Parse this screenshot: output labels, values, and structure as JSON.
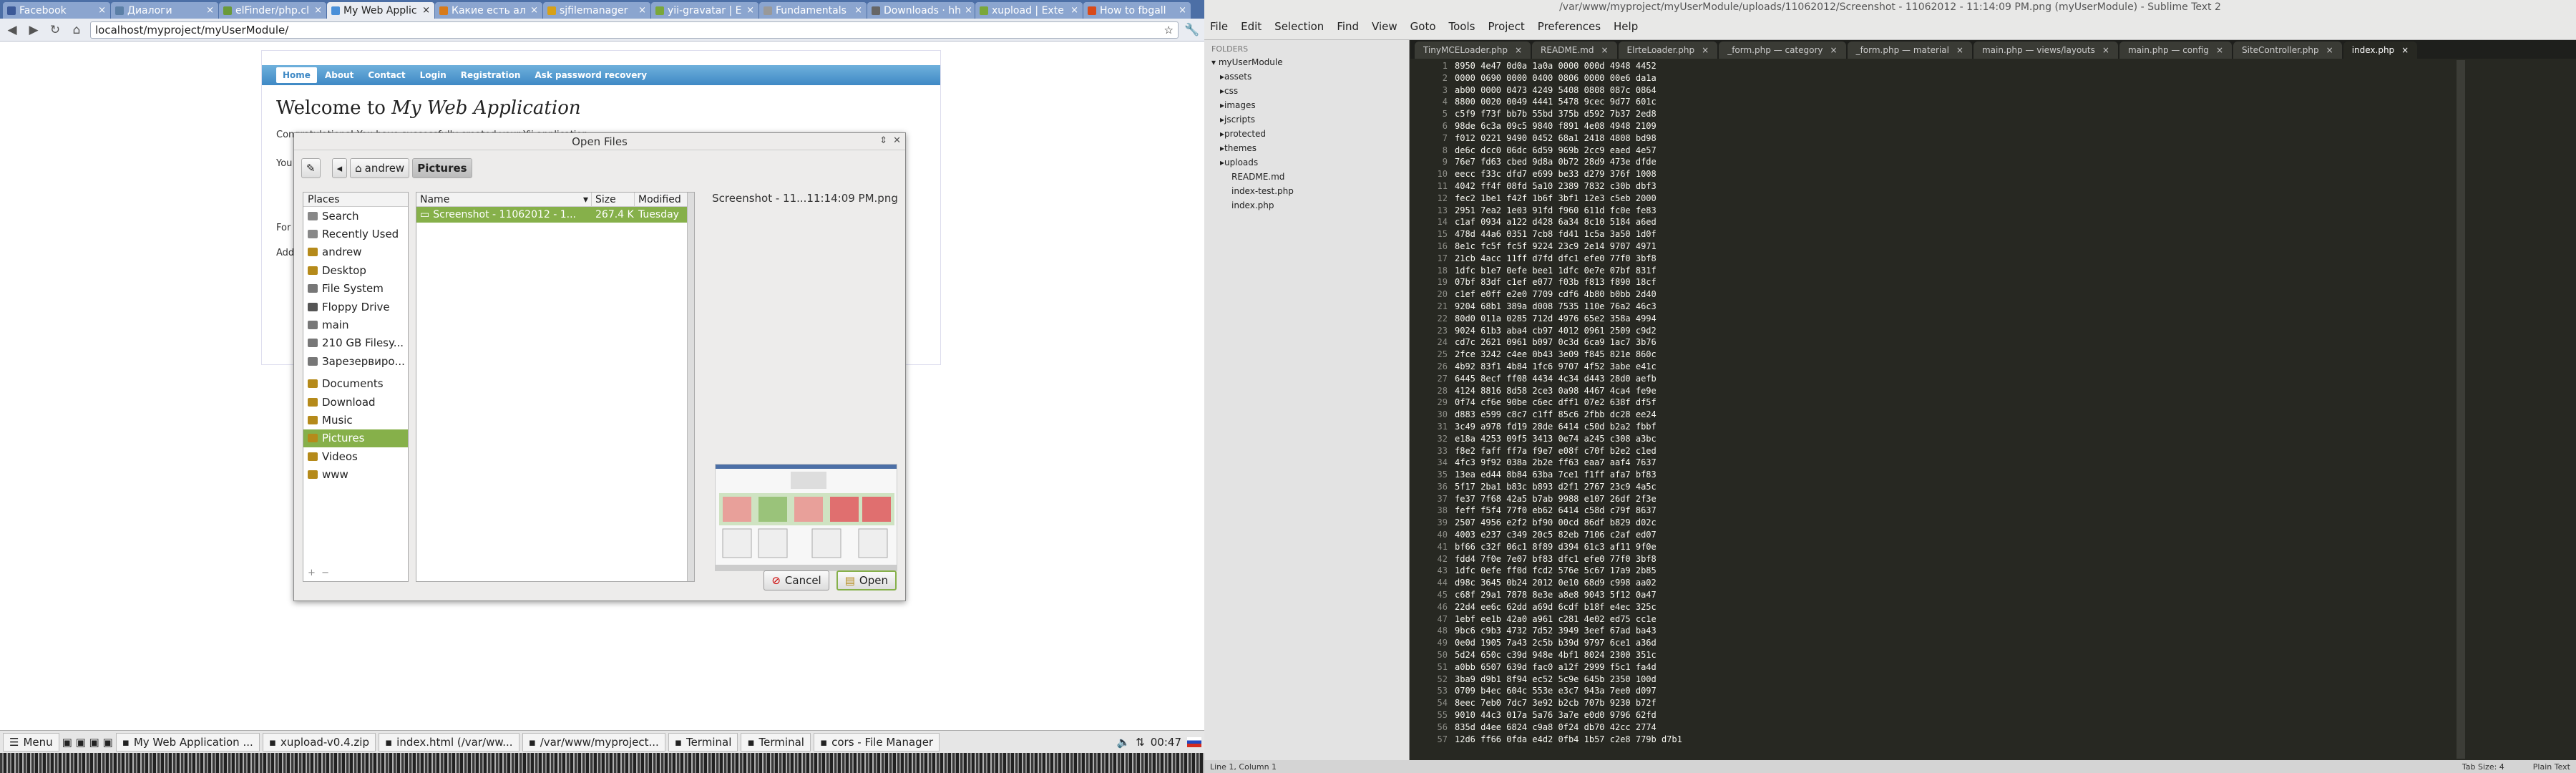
{
  "chrome": {
    "tabs": [
      {
        "label": "Facebook",
        "color": "#3b5998"
      },
      {
        "label": "Диалоги",
        "color": "#5b7fa6"
      },
      {
        "label": "elFinder/php.cl",
        "color": "#6a9a3a"
      },
      {
        "label": "My Web Applic",
        "color": "#4a90d9"
      },
      {
        "label": "Какие есть ал",
        "color": "#d77a1a"
      },
      {
        "label": "sjfilemanager",
        "color": "#d6a018"
      },
      {
        "label": "yii-gravatar | E",
        "color": "#7aa73a"
      },
      {
        "label": "Fundamentals",
        "color": "#999999"
      },
      {
        "label": "Downloads · hh",
        "color": "#666666"
      },
      {
        "label": "xupload | Exte",
        "color": "#7aa73a"
      },
      {
        "label": "How to fbgall",
        "color": "#d84a1a"
      }
    ],
    "url": "localhost/myproject/myUserModule/"
  },
  "site": {
    "nav": [
      "Home",
      "About",
      "Contact",
      "Login",
      "Registration",
      "Ask password recovery"
    ],
    "welcome_prefix": "Welcome to ",
    "welcome_app": "My Web Application",
    "line1": "Congratulations! You have successfully created your Yii application.",
    "line2": "You",
    "line3": "For m",
    "line4": "Add"
  },
  "dialog": {
    "title": "Open Files",
    "path": [
      "andrew",
      "Pictures"
    ],
    "places_header": "Places",
    "places": [
      {
        "label": "Search",
        "icon": "search-icon"
      },
      {
        "label": "Recently Used",
        "icon": "clock-icon"
      },
      {
        "label": "andrew",
        "icon": "home-icon"
      },
      {
        "label": "Desktop",
        "icon": "folder-icon"
      },
      {
        "label": "File System",
        "icon": "drive-icon"
      },
      {
        "label": "Floppy Drive",
        "icon": "floppy-icon"
      },
      {
        "label": "main",
        "icon": "drive-icon"
      },
      {
        "label": "210 GB Filesy...",
        "icon": "drive-icon"
      },
      {
        "label": "Зарезервиро...",
        "icon": "drive-icon"
      },
      {
        "label": "Documents",
        "icon": "folder-icon"
      },
      {
        "label": "Download",
        "icon": "folder-icon"
      },
      {
        "label": "Music",
        "icon": "folder-icon"
      },
      {
        "label": "Pictures",
        "icon": "folder-icon"
      },
      {
        "label": "Videos",
        "icon": "folder-icon"
      },
      {
        "label": "www",
        "icon": "folder-icon"
      }
    ],
    "selected_place": "Pictures",
    "columns": {
      "name": "Name",
      "size": "Size",
      "modified": "Modified"
    },
    "file": {
      "name": "Screenshot - 11062012 - 1...",
      "size": "267.4 KB",
      "modified": "Tuesday"
    },
    "preview_title": "Screenshot - 11...11:14:09 PM.png",
    "cancel": "Cancel",
    "open": "Open"
  },
  "taskbar": {
    "menu": "Menu",
    "items": [
      {
        "label": "My Web Application ...",
        "active": false
      },
      {
        "label": "xupload-v0.4.zip",
        "active": false
      },
      {
        "label": "index.html (/var/ww...",
        "active": false
      },
      {
        "label": "/var/www/myproject...",
        "active": false
      },
      {
        "label": "Terminal",
        "active": false
      },
      {
        "label": "Terminal",
        "active": false
      },
      {
        "label": "cors - File Manager",
        "active": false
      }
    ],
    "clock": "00:47"
  },
  "sublime": {
    "title": "/var/www/myproject/myUserModule/uploads/11062012/Screenshot - 11062012 - 11:14:09 PM.png (myUserModule) - Sublime Text 2",
    "menu": [
      "File",
      "Edit",
      "Selection",
      "Find",
      "View",
      "Goto",
      "Tools",
      "Project",
      "Preferences",
      "Help"
    ],
    "folders_label": "FOLDERS",
    "tree_root": "myUserModule",
    "tree": [
      {
        "label": "assets",
        "type": "folder"
      },
      {
        "label": "css",
        "type": "folder"
      },
      {
        "label": "images",
        "type": "folder"
      },
      {
        "label": "jscripts",
        "type": "folder"
      },
      {
        "label": "protected",
        "type": "folder"
      },
      {
        "label": "themes",
        "type": "folder"
      },
      {
        "label": "uploads",
        "type": "folder"
      },
      {
        "label": "README.md",
        "type": "file"
      },
      {
        "label": "index-test.php",
        "type": "file"
      },
      {
        "label": "index.php",
        "type": "file"
      }
    ],
    "tabs": [
      "TinyMCELoader.php",
      "README.md",
      "ElrteLoader.php",
      "_form.php — category",
      "_form.php — material",
      "main.php — views/layouts",
      "main.php — config",
      "SiteController.php",
      "index.php"
    ],
    "status_left": "Line 1, Column 1",
    "status_tab": "Tab Size: 4",
    "status_syntax": "Plain Text",
    "code": [
      "8950 4e47 0d0a 1a0a 0000 000d 4948 4452",
      "0000 0690 0000 0400 0806 0000 00e6 da1a",
      "ab00 0000 0473 4249 5408 0808 087c 0864",
      "8800 0020 0049 4441 5478 9cec 9d77 601c",
      "c5f9 f73f bb7b 55bd 375b d592 7b37 2ed8",
      "98de 6c3a 09c5 9840 f891 4e08 4948 2109",
      "f012 0221 9490 0452 68a1 2418 4808 bd98",
      "de6c dcc0 06dc 6d59 969b 2cc9 eaed 4e57",
      "76e7 fd63 cbed 9d8a 0b72 28d9 473e dfde",
      "eecc f33c dfd7 e699 be33 d279 376f 1008",
      "4042 ff4f 08fd 5a10 2389 7832 c30b dbf3",
      "fec2 1be1 f42f 1b6f 3bf1 12e3 c5eb 2000",
      "2951 7ea2 1e03 91fd f960 611d fc0e fe83",
      "c1af 0934 a122 d428 6a34 8c10 5184 a6ed",
      "478d 44a6 0351 7cb8 fd41 1c5a 3a50 1d0f",
      "8e1c fc5f fc5f 9224 23c9 2e14 9707 4971",
      "21cb 4acc 11ff d7fd dfc1 efe0 77f0 3bf8",
      "1dfc b1e7 0efe bee1 1dfc 0e7e 07bf 831f",
      "07bf 83df c1ef e077 f03b f813 f890 18cf",
      "c1ef e0ff e2e0 7709 cdf6 4b80 b0bb 2d40",
      "9204 68b1 389a d008 7535 110e 76a2 46c3",
      "80d0 011a 0285 712d 4976 65e2 358a 4994",
      "9024 61b3 aba4 cb97 4012 0961 2509 c9d2",
      "cd7c 2621 0961 b097 0c3d 6ca9 1ac7 3b76",
      "2fce 3242 c4ee 0b43 3e09 f845 821e 860c",
      "4b92 83f1 4b84 1fc6 9707 4f52 3abe e41c",
      "6445 8ecf ff08 4434 4c34 d443 28d0 aefb",
      "4124 8816 8d58 2ce3 0a98 4467 4ca4 fe9e",
      "0f74 cf6e 90be c6ec dff1 07e2 638f df5f",
      "d883 e599 c8c7 c1ff 85c6 2fbb dc28 ee24",
      "3c49 a978 fd19 28de 6414 c50d b2a2 fbbf",
      "e18a 4253 09f5 3413 0e74 a245 c308 a3bc",
      "f8e2 faff ff7a f9e7 e08f c70f b2e2 c1ed",
      "4fc3 9f92 038a 2b2e ff63 eaa7 aaf4 7637",
      "13ea ed44 8b84 63ba 7ce1 f1ff afa7 bf83",
      "5f17 2ba1 b83c b893 d2f1 2767 23c9 4a5c",
      "fe37 7f68 42a5 b7ab 9988 e107 26df 2f3e",
      "feff f5f4 77f0 eb62 6414 c58d c79f 8637",
      "2507 4956 e2f2 bf90 00cd 86df b829 d02c",
      "4003 e237 c349 20c5 82eb 7106 c2af ed07",
      "bf66 c32f 06c1 8f89 d394 61c3 af11 9f0e",
      "fdd4 7f0e 7e07 bf83 dfc1 efe0 77f0 3bf8",
      "1dfc 0efe ff0d fcd2 576e 5c67 17a9 2b85",
      "d98c 3645 0b24 2012 0e10 68d9 c998 aa02",
      "c68f 29a1 7878 8e3e a8e8 9043 5f12 0a47",
      "22d4 ee6c 62dd a69d 6cdf b18f e4ec 325c",
      "1ebf ee1b 42a0 a961 c281 4e02 ed75 cc1e",
      "9bc6 c9b3 4732 7d52 3949 3eef 67ad ba43",
      "0e0d 1905 7a43 2c5b b39d 9797 6ce1 a36d",
      "5d24 650c c39d 948e 4bf1 8024 2300 351c",
      "a0bb 6507 639d fac0 a12f 2999 f5c1 fa4d",
      "3ba9 d9b1 8f94 ec52 5c9e 645b 2350 100d",
      "0709 b4ec 604c 553e e3c7 943a 7ee0 d097",
      "8eec 7eb0 7dc7 3e92 b2cb 707b 9230 b72f",
      "9010 44c3 017a 5a76 3a7e e0d0 9796 62fd",
      "835d d4ee 6824 c9a8 0f24 db70 42cc 2774",
      "12d6 ff66 0fda e4d2 0fb4 1b57 c2e8 779b d7b1"
    ]
  }
}
